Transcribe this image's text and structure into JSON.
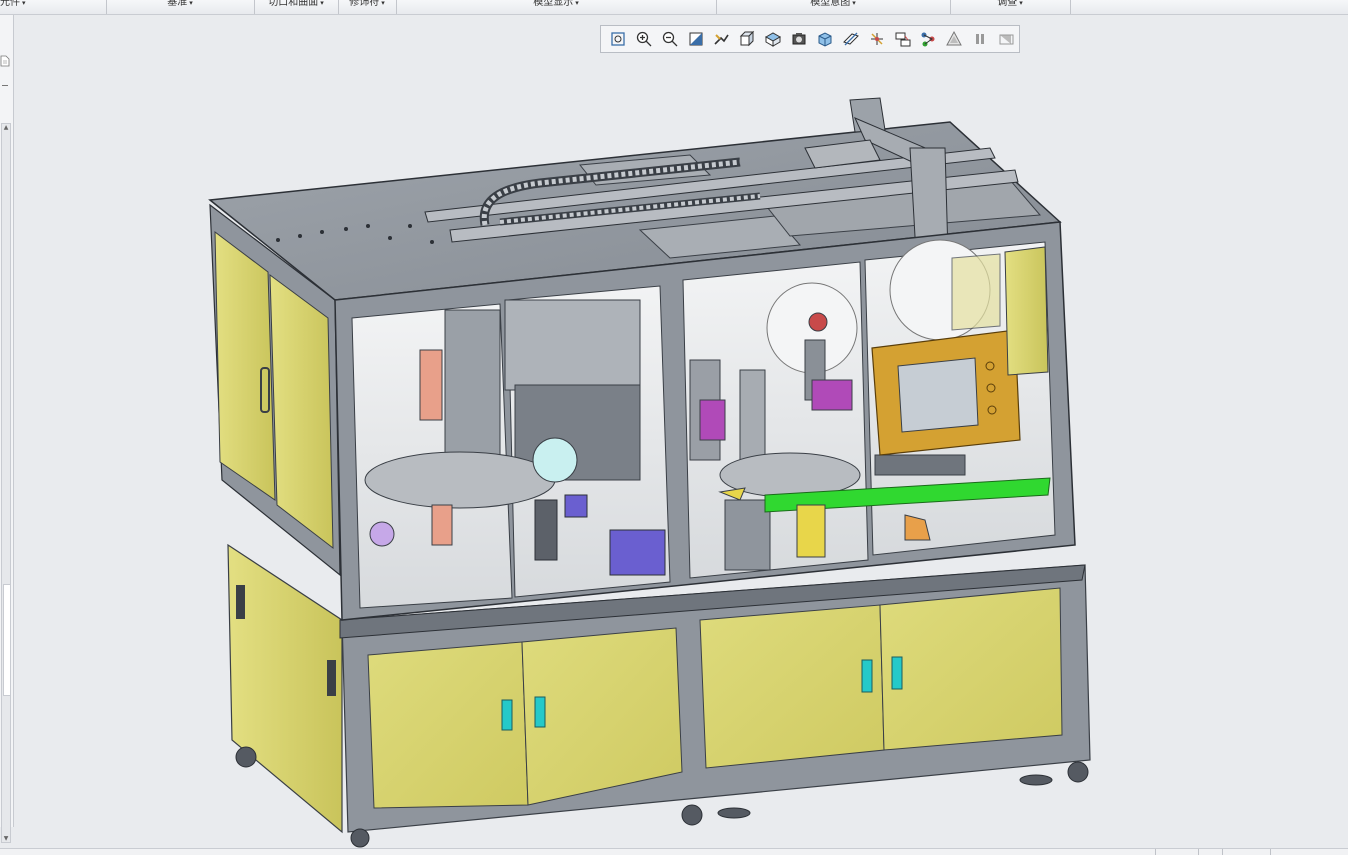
{
  "ribbon": {
    "groups": [
      {
        "label": "元件",
        "arrow": "▾"
      },
      {
        "label": "基准",
        "arrow": "▾"
      },
      {
        "label": "切口和曲面",
        "arrow": "▾"
      },
      {
        "label": "修饰符",
        "arrow": "▾"
      },
      {
        "label": "模型显示",
        "arrow": "▾"
      },
      {
        "label": "模型意图",
        "arrow": "▾"
      },
      {
        "label": "调查",
        "arrow": "▾"
      }
    ]
  },
  "graphics_toolbar": {
    "buttons": [
      {
        "icon": "refit-icon"
      },
      {
        "icon": "zoom-in-icon"
      },
      {
        "icon": "zoom-out-icon"
      },
      {
        "icon": "repaint-icon"
      },
      {
        "icon": "pan-icon"
      },
      {
        "icon": "saved-orientations-icon"
      },
      {
        "icon": "view-manager-icon"
      },
      {
        "icon": "perspective-view-icon"
      },
      {
        "icon": "display-style-icon"
      },
      {
        "icon": "datum-display-icon"
      },
      {
        "icon": "spin-center-icon"
      },
      {
        "icon": "annotation-display-icon"
      },
      {
        "icon": "explode-view-icon"
      },
      {
        "icon": "appearance-icon"
      },
      {
        "icon": "pause-icon"
      },
      {
        "icon": "next-icon"
      }
    ]
  },
  "colors": {
    "frame_panel": "#d8d36f",
    "structure": "#8f959d",
    "guard_green": "#30d830",
    "hmi_housing": "#d4a132",
    "handle_cyan": "#25c9c9",
    "accent_purple": "#8a3fc8",
    "hmi_screen": "#c6cdd4"
  }
}
